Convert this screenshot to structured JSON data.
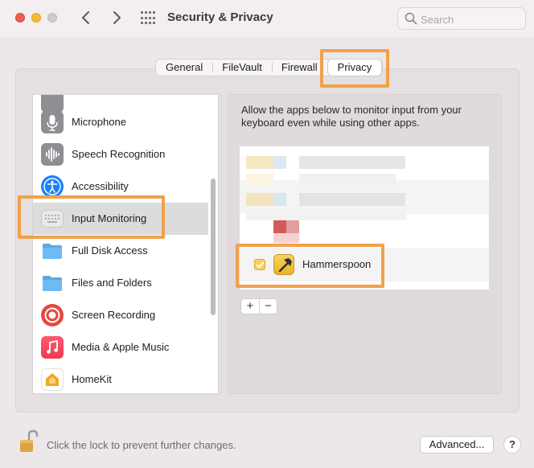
{
  "window": {
    "title": "Security & Privacy",
    "search_placeholder": "Search"
  },
  "tabs": [
    {
      "label": "General",
      "selected": false
    },
    {
      "label": "FileVault",
      "selected": false
    },
    {
      "label": "Firewall",
      "selected": false
    },
    {
      "label": "Privacy",
      "selected": true
    }
  ],
  "sidebar": {
    "items": [
      {
        "label": "Microphone",
        "icon": "microphone-icon"
      },
      {
        "label": "Speech Recognition",
        "icon": "waveform-icon"
      },
      {
        "label": "Accessibility",
        "icon": "accessibility-icon"
      },
      {
        "label": "Input Monitoring",
        "icon": "keyboard-icon",
        "selected": true
      },
      {
        "label": "Full Disk Access",
        "icon": "folder-icon"
      },
      {
        "label": "Files and Folders",
        "icon": "folder-icon"
      },
      {
        "label": "Screen Recording",
        "icon": "screen-recording-icon"
      },
      {
        "label": "Media & Apple Music",
        "icon": "music-icon"
      },
      {
        "label": "HomeKit",
        "icon": "home-icon"
      }
    ]
  },
  "detail": {
    "description": "Allow the apps below to monitor input from your keyboard even while using other apps.",
    "apps": [
      {
        "name": "Hammerspoon",
        "checked": true,
        "icon": "hammer-icon"
      }
    ],
    "add_label": "+",
    "remove_label": "−"
  },
  "footer": {
    "lock_text": "Click the lock to prevent further changes.",
    "advanced_label": "Advanced...",
    "help_label": "?"
  },
  "colors": {
    "highlight": "#f2a14a",
    "checkbox": "#f6cf5a"
  }
}
